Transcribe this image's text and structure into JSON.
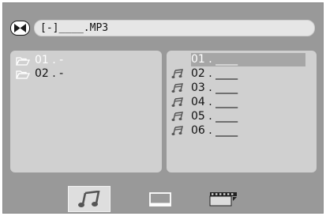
{
  "header": {
    "icon": "mp3-disc-icon",
    "path": "[-]____.MP3"
  },
  "folders": [
    {
      "label": "01 . -",
      "icon": "folder-icon",
      "selected": true
    },
    {
      "label": "02 . -",
      "icon": "folder-icon",
      "selected": false
    }
  ],
  "files": [
    {
      "label": "01 . ____",
      "icon": "none",
      "selected": true
    },
    {
      "label": "02 . ____",
      "icon": "music-note-icon",
      "selected": false
    },
    {
      "label": "03 . ____",
      "icon": "music-note-icon",
      "selected": false
    },
    {
      "label": "04 . ____",
      "icon": "music-note-icon",
      "selected": false
    },
    {
      "label": "05 . ____",
      "icon": "music-note-icon",
      "selected": false
    },
    {
      "label": "06 . ____",
      "icon": "music-note-icon",
      "selected": false
    }
  ],
  "tabs": [
    {
      "name": "music-tab",
      "icon": "music-note-icon",
      "active": true
    },
    {
      "name": "photo-tab",
      "icon": "photo-icon",
      "active": false
    },
    {
      "name": "movie-tab",
      "icon": "film-icon",
      "active": false
    }
  ],
  "colors": {
    "background": "#999999",
    "panel": "#d0d0d0",
    "selection": "#a6a6a6",
    "active_tab": "#dedede"
  }
}
